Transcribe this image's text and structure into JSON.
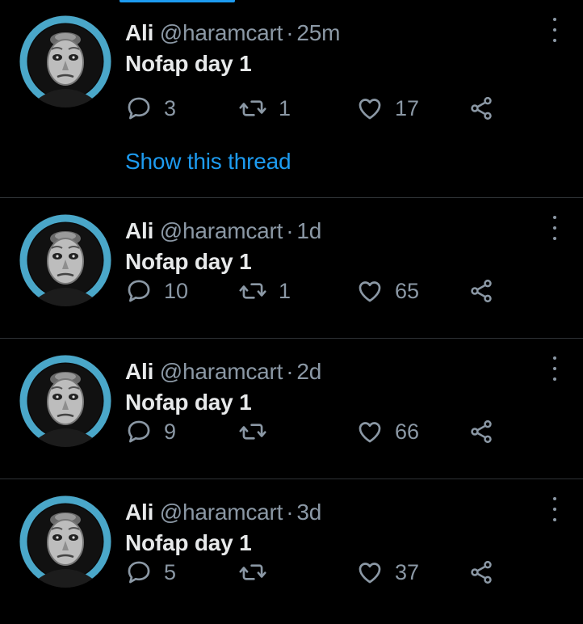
{
  "colors": {
    "background": "#000000",
    "text_primary": "#e7e9ea",
    "text_secondary": "#8b98a5",
    "accent": "#1d9bf0",
    "avatar_ring": "#4aa7c9",
    "divider": "#2f3336"
  },
  "show_thread_label": "Show this thread",
  "tweets": [
    {
      "name": "Ali",
      "handle": "@haramcart",
      "dot": "·",
      "time": "25m",
      "text": "Nofap day 1",
      "replies": "3",
      "retweets": "1",
      "likes": "17"
    },
    {
      "name": "Ali",
      "handle": "@haramcart",
      "dot": "·",
      "time": "1d",
      "text": "Nofap day 1",
      "replies": "10",
      "retweets": "1",
      "likes": "65"
    },
    {
      "name": "Ali",
      "handle": "@haramcart",
      "dot": "·",
      "time": "2d",
      "text": "Nofap day 1",
      "replies": "9",
      "retweets": "",
      "likes": "66"
    },
    {
      "name": "Ali",
      "handle": "@haramcart",
      "dot": "·",
      "time": "3d",
      "text": "Nofap day 1",
      "replies": "5",
      "retweets": "",
      "likes": "37"
    }
  ]
}
